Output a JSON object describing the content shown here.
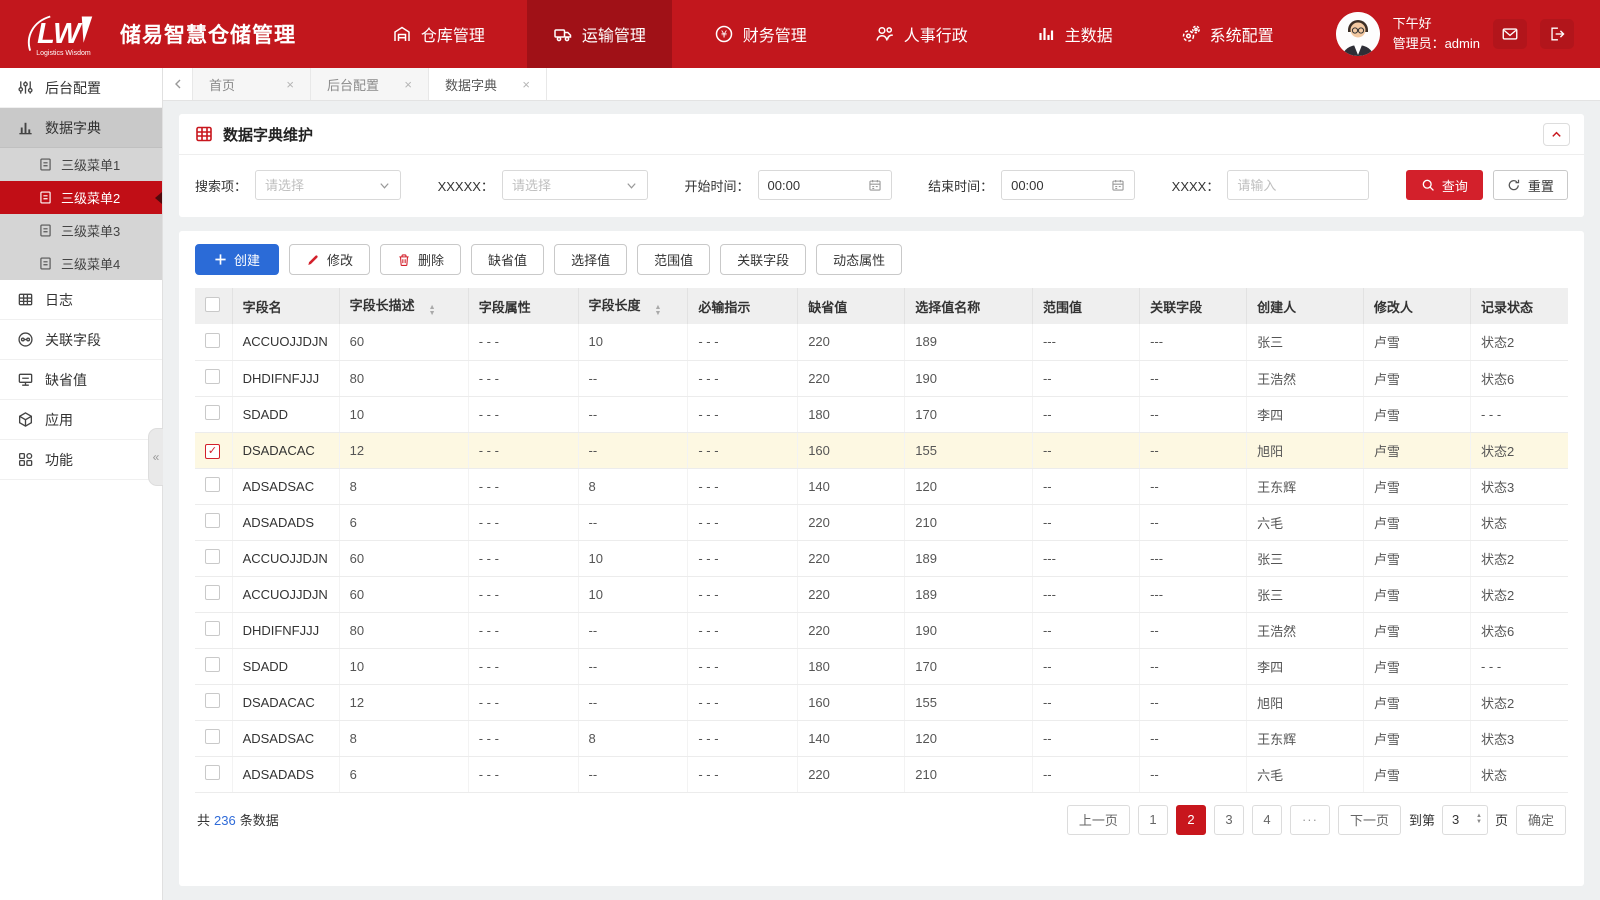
{
  "colors": {
    "header_red": "#c2171d",
    "header_active_red": "#a01117",
    "sidebar_active_red": "#c10e16",
    "accent_red": "#d3202b",
    "primary_blue": "#2b6bd7",
    "link_blue": "#2f6bd8",
    "row_highlight": "#fdf8e2"
  },
  "header": {
    "title": "储易智慧仓储管理",
    "logo_text": "LW",
    "logo_subtitle": "Logistics Wisdom",
    "nav": [
      {
        "label": "仓库管理",
        "icon": "warehouse-icon",
        "active": false
      },
      {
        "label": "运输管理",
        "icon": "truck-icon",
        "active": true
      },
      {
        "label": "财务管理",
        "icon": "finance-icon",
        "active": false
      },
      {
        "label": "人事行政",
        "icon": "people-icon",
        "active": false
      },
      {
        "label": "主数据",
        "icon": "bar-chart-icon",
        "active": false
      },
      {
        "label": "系统配置",
        "icon": "gears-icon",
        "active": false
      }
    ],
    "greeting": "下午好",
    "user_role": "管理员：admin"
  },
  "sidebar": {
    "items": [
      {
        "label": "后台配置",
        "icon": "sliders-icon"
      },
      {
        "label": "数据字典",
        "icon": "data-dict-icon",
        "expanded": true,
        "children": [
          {
            "label": "三级菜单1",
            "active": false
          },
          {
            "label": "三级菜单2",
            "active": true
          },
          {
            "label": "三级菜单3",
            "active": false
          },
          {
            "label": "三级菜单4",
            "active": false
          }
        ]
      },
      {
        "label": "日志",
        "icon": "log-grid-icon"
      },
      {
        "label": "关联字段",
        "icon": "link-icon"
      },
      {
        "label": "缺省值",
        "icon": "monitor-icon"
      },
      {
        "label": "应用",
        "icon": "cube-icon"
      },
      {
        "label": "功能",
        "icon": "apps-icon"
      }
    ],
    "collapse_glyph": "«"
  },
  "tabs": [
    {
      "label": "首页",
      "active": false
    },
    {
      "label": "后台配置",
      "active": false
    },
    {
      "label": "数据字典",
      "active": true
    }
  ],
  "panel": {
    "title": "数据字典维护"
  },
  "filters": {
    "search_item": {
      "label": "搜索项：",
      "placeholder": "请选择"
    },
    "xxxxx": {
      "label": "XXXXX：",
      "placeholder": "请选择"
    },
    "start_time": {
      "label": "开始时间：",
      "value": "00:00"
    },
    "end_time": {
      "label": "结束时间：",
      "value": "00:00"
    },
    "xxxx": {
      "label": "XXXX：",
      "placeholder": "请输入"
    },
    "query_label": "查询",
    "reset_label": "重置"
  },
  "toolbar": {
    "create": "创建",
    "edit": "修改",
    "delete": "删除",
    "default_value": "缺省值",
    "select_value": "选择值",
    "range_value": "范围值",
    "related_field": "关联字段",
    "dynamic_attr": "动态属性"
  },
  "table": {
    "columns": [
      "字段名",
      "字段长描述",
      "字段属性",
      "字段长度",
      "必输指示",
      "缺省值",
      "选择值名称",
      "范围值",
      "关联字段",
      "创建人",
      "修改人",
      "记录状态"
    ],
    "sortable_columns": [
      "字段长描述",
      "字段长度"
    ],
    "rows": [
      {
        "checked": false,
        "highlight": false,
        "cells": [
          "ACCUOJJDJN",
          "60",
          "- - -",
          "10",
          "- - -",
          "220",
          "189",
          "---",
          "---",
          "张三",
          "卢雪",
          "状态2"
        ]
      },
      {
        "checked": false,
        "highlight": false,
        "cells": [
          "DHDIFNFJJJ",
          "80",
          "- - -",
          "--",
          "- - -",
          "220",
          "190",
          "--",
          "--",
          "王浩然",
          "卢雪",
          "状态6"
        ]
      },
      {
        "checked": false,
        "highlight": false,
        "cells": [
          "SDADD",
          "10",
          "- - -",
          "--",
          "- - -",
          "180",
          "170",
          "--",
          "--",
          "李四",
          "卢雪",
          "- - -"
        ]
      },
      {
        "checked": true,
        "highlight": true,
        "cells": [
          "DSADACAC",
          "12",
          "- - -",
          "--",
          "- - -",
          "160",
          "155",
          "--",
          "--",
          "旭阳",
          "卢雪",
          "状态2"
        ]
      },
      {
        "checked": false,
        "highlight": false,
        "cells": [
          "ADSADSAC",
          "8",
          "- - -",
          "8",
          "- - -",
          "140",
          "120",
          "--",
          "--",
          "王东辉",
          "卢雪",
          "状态3"
        ]
      },
      {
        "checked": false,
        "highlight": false,
        "cells": [
          "ADSADADS",
          "6",
          "- - -",
          "--",
          "- - -",
          "220",
          "210",
          "--",
          "--",
          "六毛",
          "卢雪",
          "状态"
        ]
      },
      {
        "checked": false,
        "highlight": false,
        "cells": [
          "ACCUOJJDJN",
          "60",
          "- - -",
          "10",
          "- - -",
          "220",
          "189",
          "---",
          "---",
          "张三",
          "卢雪",
          "状态2"
        ]
      },
      {
        "checked": false,
        "highlight": false,
        "cells": [
          "ACCUOJJDJN",
          "60",
          "- - -",
          "10",
          "- - -",
          "220",
          "189",
          "---",
          "---",
          "张三",
          "卢雪",
          "状态2"
        ]
      },
      {
        "checked": false,
        "highlight": false,
        "cells": [
          "DHDIFNFJJJ",
          "80",
          "- - -",
          "--",
          "- - -",
          "220",
          "190",
          "--",
          "--",
          "王浩然",
          "卢雪",
          "状态6"
        ]
      },
      {
        "checked": false,
        "highlight": false,
        "cells": [
          "SDADD",
          "10",
          "- - -",
          "--",
          "- - -",
          "180",
          "170",
          "--",
          "--",
          "李四",
          "卢雪",
          "- - -"
        ]
      },
      {
        "checked": false,
        "highlight": false,
        "cells": [
          "DSADACAC",
          "12",
          "- - -",
          "--",
          "- - -",
          "160",
          "155",
          "--",
          "--",
          "旭阳",
          "卢雪",
          "状态2"
        ]
      },
      {
        "checked": false,
        "highlight": false,
        "cells": [
          "ADSADSAC",
          "8",
          "- - -",
          "8",
          "- - -",
          "140",
          "120",
          "--",
          "--",
          "王东辉",
          "卢雪",
          "状态3"
        ]
      },
      {
        "checked": false,
        "highlight": false,
        "cells": [
          "ADSADADS",
          "6",
          "- - -",
          "--",
          "- - -",
          "220",
          "210",
          "--",
          "--",
          "六毛",
          "卢雪",
          "状态"
        ]
      }
    ]
  },
  "footer": {
    "total_prefix": "共",
    "total_count": "236",
    "total_suffix": "条数据",
    "pagination": {
      "prev": "上一页",
      "pages": [
        "1",
        "2",
        "3",
        "4"
      ],
      "active_page": "2",
      "ellipsis": "···",
      "next": "下一页",
      "jump_prefix": "到第",
      "jump_value": "3",
      "jump_suffix": "页",
      "confirm": "确定"
    }
  }
}
